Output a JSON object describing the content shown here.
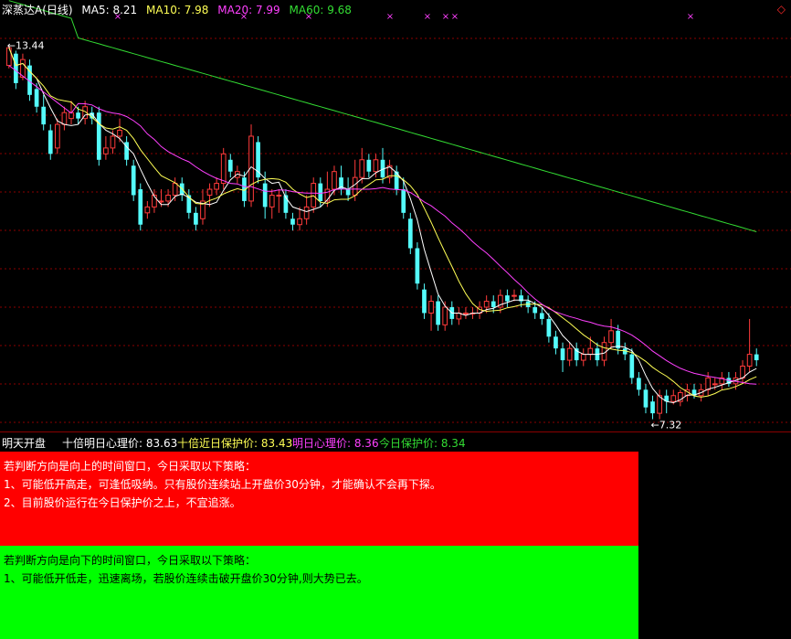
{
  "header": {
    "stock_name": "深蒸达A",
    "period": "(日线)",
    "ma5": "MA5: 8.21",
    "ma10": "MA10: 7.98",
    "ma20": "MA20: 7.99",
    "ma60": "MA60: 9.68"
  },
  "colors": {
    "up": "#ff3b3b",
    "down": "#54fcfc",
    "ma5": "#ffffff",
    "ma10": "#ffff55",
    "ma20": "#ff40ff",
    "ma60": "#33dd33",
    "grid": "#8b0000"
  },
  "chart_data": {
    "type": "candlestick",
    "ylim": [
      7.0,
      13.9
    ],
    "annotations": [
      {
        "label": "13.44",
        "kind": "max"
      },
      {
        "label": "7.32",
        "kind": "min"
      }
    ],
    "candles": [
      [
        13.1,
        13.4,
        13.44,
        13.05
      ],
      [
        13.3,
        12.8,
        13.35,
        12.7
      ],
      [
        12.9,
        13.2,
        13.3,
        12.85
      ],
      [
        13.1,
        12.6,
        13.2,
        12.5
      ],
      [
        12.7,
        12.4,
        12.8,
        12.3
      ],
      [
        12.4,
        12.1,
        12.6,
        12.0
      ],
      [
        12.0,
        11.6,
        12.1,
        11.5
      ],
      [
        11.7,
        12.1,
        12.2,
        11.6
      ],
      [
        12.1,
        12.3,
        12.4,
        12.0
      ],
      [
        12.2,
        12.3,
        12.5,
        12.1
      ],
      [
        12.3,
        12.2,
        12.4,
        12.1
      ],
      [
        12.2,
        12.4,
        12.5,
        12.1
      ],
      [
        12.3,
        12.2,
        12.4,
        12.1
      ],
      [
        12.3,
        11.5,
        12.4,
        11.4
      ],
      [
        11.6,
        11.7,
        11.9,
        11.5
      ],
      [
        11.7,
        11.9,
        12.0,
        11.6
      ],
      [
        11.9,
        12.0,
        12.2,
        11.8
      ],
      [
        11.8,
        11.5,
        11.9,
        11.4
      ],
      [
        11.4,
        10.9,
        11.5,
        10.8
      ],
      [
        11.0,
        10.4,
        11.1,
        10.3
      ],
      [
        10.6,
        10.7,
        10.8,
        10.5
      ],
      [
        10.7,
        10.9,
        11.0,
        10.6
      ],
      [
        10.8,
        10.8,
        11.0,
        10.7
      ],
      [
        10.8,
        10.9,
        11.0,
        10.7
      ],
      [
        10.9,
        11.1,
        11.2,
        10.8
      ],
      [
        11.1,
        10.9,
        11.2,
        10.8
      ],
      [
        10.9,
        10.6,
        11.0,
        10.5
      ],
      [
        10.6,
        10.4,
        10.7,
        10.3
      ],
      [
        10.5,
        10.8,
        11.0,
        10.4
      ],
      [
        10.9,
        11.0,
        11.1,
        10.7
      ],
      [
        11.0,
        11.1,
        11.2,
        10.9
      ],
      [
        11.1,
        11.6,
        11.7,
        11.0
      ],
      [
        11.5,
        11.3,
        11.6,
        11.2
      ],
      [
        11.2,
        11.3,
        11.4,
        11.1
      ],
      [
        11.2,
        10.8,
        11.3,
        10.7
      ],
      [
        10.8,
        11.9,
        12.1,
        10.7
      ],
      [
        11.8,
        11.2,
        11.9,
        11.1
      ],
      [
        11.1,
        10.7,
        11.3,
        10.5
      ],
      [
        10.7,
        10.9,
        11.0,
        10.5
      ],
      [
        10.9,
        10.9,
        11.0,
        10.6
      ],
      [
        10.9,
        10.6,
        11.0,
        10.5
      ],
      [
        10.5,
        10.4,
        10.6,
        10.3
      ],
      [
        10.4,
        10.5,
        10.7,
        10.3
      ],
      [
        10.5,
        10.7,
        10.9,
        10.4
      ],
      [
        10.7,
        11.1,
        11.2,
        10.6
      ],
      [
        11.1,
        10.8,
        11.2,
        10.7
      ],
      [
        10.8,
        11.0,
        11.3,
        10.7
      ],
      [
        11.0,
        11.3,
        11.4,
        10.9
      ],
      [
        11.2,
        11.0,
        11.4,
        10.9
      ],
      [
        11.0,
        10.9,
        11.2,
        10.8
      ],
      [
        10.9,
        11.2,
        11.5,
        10.8
      ],
      [
        11.2,
        11.5,
        11.7,
        11.1
      ],
      [
        11.5,
        11.3,
        11.6,
        11.2
      ],
      [
        11.3,
        11.5,
        11.6,
        11.2
      ],
      [
        11.5,
        11.2,
        11.7,
        11.1
      ],
      [
        11.2,
        11.4,
        11.5,
        11.1
      ],
      [
        11.3,
        11.0,
        11.4,
        10.9
      ],
      [
        11.0,
        10.6,
        11.2,
        10.5
      ],
      [
        10.5,
        10.0,
        10.6,
        9.9
      ],
      [
        10.0,
        9.4,
        10.1,
        9.3
      ],
      [
        9.3,
        8.9,
        9.4,
        8.8
      ],
      [
        8.9,
        9.1,
        9.2,
        8.6
      ],
      [
        9.1,
        8.7,
        9.2,
        8.6
      ],
      [
        8.7,
        9.0,
        9.1,
        8.6
      ],
      [
        9.0,
        8.8,
        9.1,
        8.7
      ],
      [
        8.8,
        8.9,
        9.0,
        8.7
      ],
      [
        8.9,
        8.9,
        9.0,
        8.8
      ],
      [
        8.9,
        8.9,
        9.0,
        8.8
      ],
      [
        8.9,
        9.0,
        9.1,
        8.8
      ],
      [
        9.0,
        9.1,
        9.2,
        8.9
      ],
      [
        9.1,
        9.0,
        9.2,
        8.9
      ],
      [
        9.0,
        9.2,
        9.3,
        8.9
      ],
      [
        9.2,
        9.1,
        9.3,
        9.0
      ],
      [
        9.2,
        9.2,
        9.3,
        9.1
      ],
      [
        9.2,
        9.1,
        9.3,
        9.0
      ],
      [
        9.1,
        9.0,
        9.2,
        8.9
      ],
      [
        9.0,
        8.9,
        9.1,
        8.8
      ],
      [
        8.9,
        8.8,
        9.0,
        8.7
      ],
      [
        8.8,
        8.5,
        8.9,
        8.4
      ],
      [
        8.5,
        8.3,
        8.6,
        8.2
      ],
      [
        8.3,
        8.1,
        8.4,
        7.9
      ],
      [
        8.1,
        8.3,
        8.4,
        8.0
      ],
      [
        8.3,
        8.1,
        8.4,
        8.0
      ],
      [
        8.1,
        8.2,
        8.3,
        8.0
      ],
      [
        8.2,
        8.3,
        8.5,
        8.1
      ],
      [
        8.3,
        8.1,
        8.4,
        8.0
      ],
      [
        8.1,
        8.4,
        8.5,
        8.0
      ],
      [
        8.4,
        8.6,
        8.8,
        8.3
      ],
      [
        8.6,
        8.3,
        8.7,
        8.2
      ],
      [
        8.3,
        8.2,
        8.4,
        8.1
      ],
      [
        8.2,
        7.8,
        8.3,
        7.7
      ],
      [
        7.8,
        7.6,
        7.9,
        7.5
      ],
      [
        7.6,
        7.3,
        7.7,
        7.2
      ],
      [
        7.4,
        7.2,
        7.5,
        7.1
      ],
      [
        7.2,
        7.5,
        7.6,
        7.1
      ],
      [
        7.5,
        7.4,
        7.6,
        7.2
      ],
      [
        7.4,
        7.5,
        7.6,
        7.35
      ],
      [
        7.4,
        7.55,
        7.6,
        7.32
      ],
      [
        7.5,
        7.6,
        7.7,
        7.4
      ],
      [
        7.6,
        7.5,
        7.7,
        7.45
      ],
      [
        7.5,
        7.6,
        7.7,
        7.4
      ],
      [
        7.6,
        7.8,
        7.9,
        7.5
      ],
      [
        7.7,
        7.7,
        7.8,
        7.6
      ],
      [
        7.7,
        7.8,
        7.9,
        7.6
      ],
      [
        7.8,
        7.7,
        7.9,
        7.65
      ],
      [
        7.7,
        7.8,
        7.9,
        7.6
      ],
      [
        7.8,
        8.0,
        8.1,
        7.7
      ],
      [
        8.0,
        8.2,
        8.8,
        7.9
      ],
      [
        8.2,
        8.1,
        8.3,
        8.0
      ]
    ],
    "ma60_line": [
      13.3,
      11.5,
      9.68
    ]
  },
  "markers": {
    "symbol": "×",
    "count": 8
  },
  "info_bar": {
    "label1": "明天开盘",
    "label2": "十倍明日心理价: 83.63",
    "label3": "十倍近日保护价: 83.43",
    "label4": "明日心理价: 8.36",
    "label5": "今日保护价: 8.34"
  },
  "up_panel": {
    "title": "若判断方向是向上的时间窗口，今日采取以下策略：",
    "line1": "1、可能低开高走，可逢低吸纳。只有股价连续站上开盘价30分钟，才能确认不会再下探。",
    "line2": "2、目前股价运行在今日保护价之上，不宜追涨。"
  },
  "down_panel": {
    "title": "若判断方向是向下的时间窗口，今日采取以下策略：",
    "line1": "1、可能低开低走，迅速离场，若股价连续击破开盘价30分钟,则大势已去。"
  },
  "corner_icon": "diamond-icon"
}
